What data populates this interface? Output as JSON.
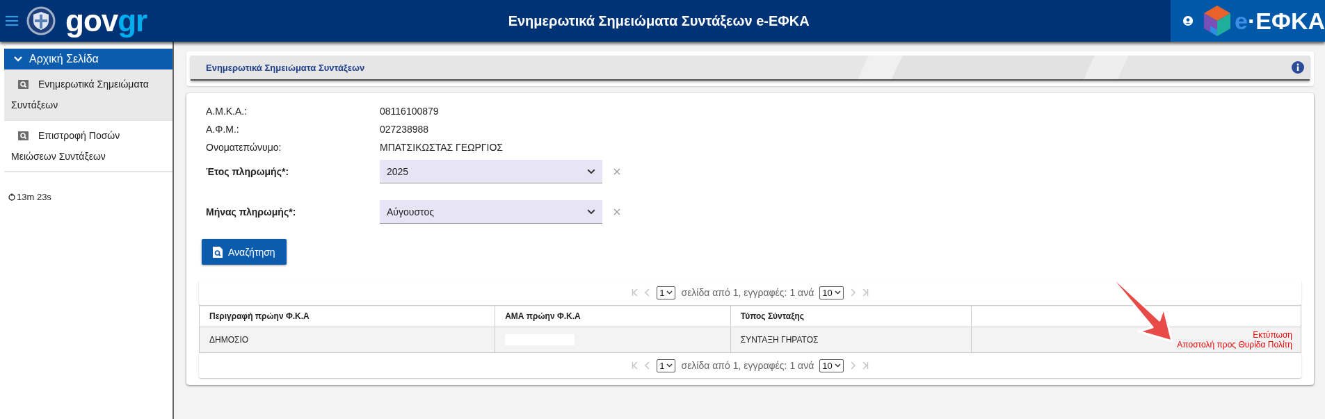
{
  "header": {
    "brand": [
      "gov",
      "gr"
    ],
    "title": "Ενημερωτικά Σημειώματα Συντάξεων e-ΕΦΚΑ",
    "agency_logo": [
      "e",
      "·ΕΦΚΑ"
    ]
  },
  "sidebar": {
    "section": {
      "label": "Αρχική Σελίδα",
      "expanded": true
    },
    "items": [
      {
        "label": "Ενημερωτικά Σημειώματα Συντάξεων",
        "selected": true
      },
      {
        "label": "Επιστροφή Ποσών Μειώσεων Συντάξεων",
        "selected": false
      }
    ],
    "timer": "13m 23s"
  },
  "page_title": "Ενημερωτικά Σημειώματα Συντάξεων",
  "info_fields": [
    {
      "label": "Α.Μ.Κ.Α.:",
      "value": "08116100879"
    },
    {
      "label": "Α.Φ.Μ.:",
      "value": "027238988"
    },
    {
      "label": "Ονοματεπώνυμο:",
      "value": "ΜΠΑΤΣΙΚΩΣΤΑΣ ΓΕΩΡΓΙΟΣ"
    }
  ],
  "filters": [
    {
      "label": "Έτος πληρωμής*:",
      "value": "2025"
    },
    {
      "label": "Μήνας πληρωμής*:",
      "value": "Αύγουστος"
    }
  ],
  "search_button": "Αναζήτηση",
  "pager_top": {
    "page": "1",
    "text": "σελίδα από 1, εγγραφές: 1 ανά",
    "page_size": "10"
  },
  "table": {
    "columns": [
      "Περιγραφή πρώην Φ.Κ.Α",
      "ΑΜΑ πρώην Φ.Κ.Α",
      "Τύπος Σύνταξης"
    ],
    "rows": [
      {
        "description": "ΔΗΜΟΣΙΟ",
        "ama_redacted": true,
        "type": "ΣΥΝΤΑΞΗ ΓΗΡΑΤΟΣ",
        "actions": [
          "Εκτύπωση",
          "Αποστολή προς Θυρίδα Πολίτη"
        ]
      }
    ]
  },
  "pager_bottom": {
    "page": "1",
    "text": "σελίδα από 1, εγγραφές: 1 ανά",
    "page_size": "10"
  }
}
